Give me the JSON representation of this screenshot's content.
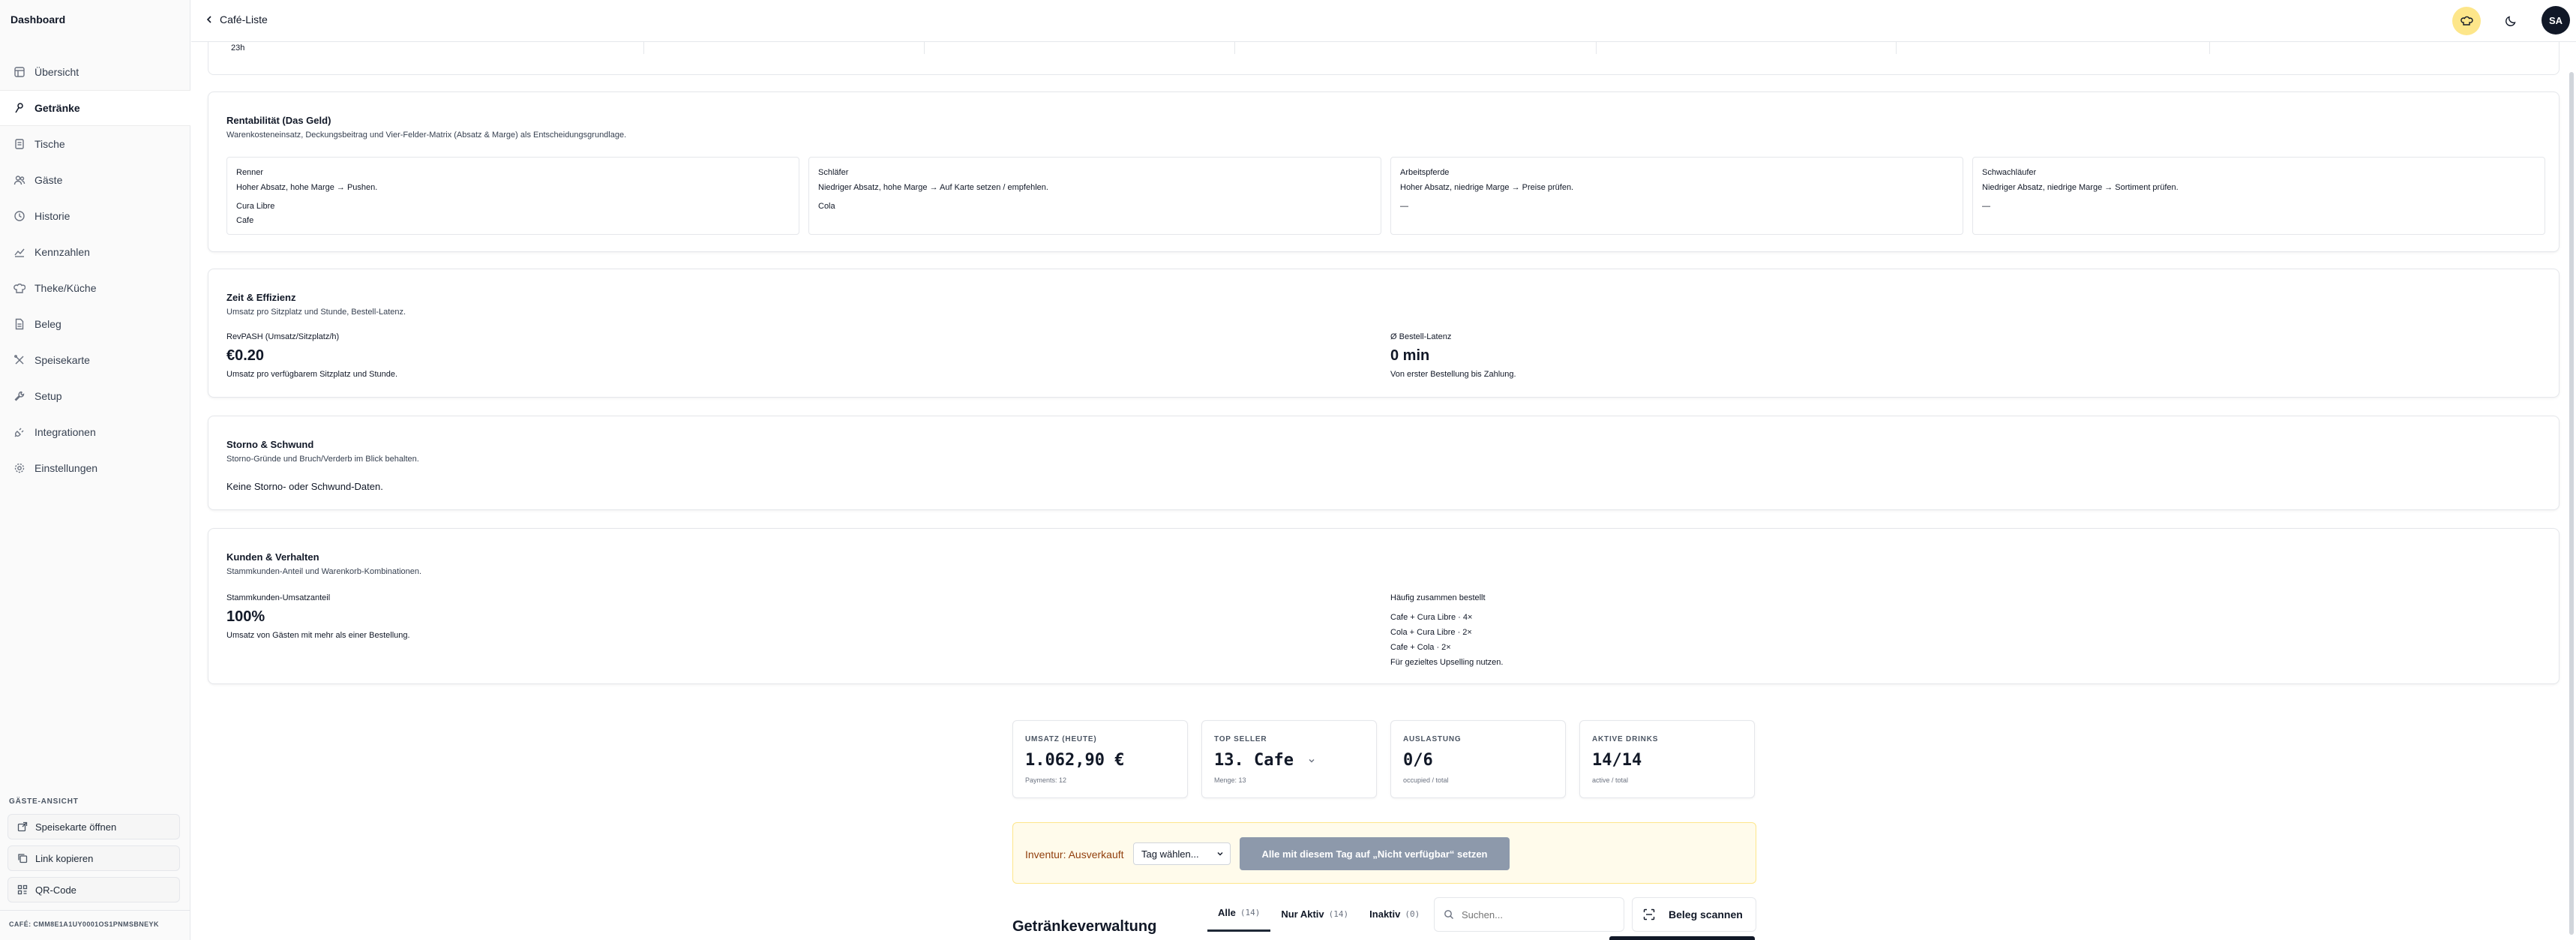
{
  "sidebar": {
    "title": "Dashboard",
    "items": [
      {
        "label": "Übersicht",
        "icon": "layout-icon"
      },
      {
        "label": "Getränke",
        "icon": "cup-icon"
      },
      {
        "label": "Tische",
        "icon": "table-icon"
      },
      {
        "label": "Gäste",
        "icon": "users-icon"
      },
      {
        "label": "Historie",
        "icon": "history-icon"
      },
      {
        "label": "Kennzahlen",
        "icon": "chart-icon"
      },
      {
        "label": "Theke/Küche",
        "icon": "chef-icon"
      },
      {
        "label": "Beleg",
        "icon": "receipt-icon"
      },
      {
        "label": "Speisekarte",
        "icon": "utensils-icon"
      },
      {
        "label": "Setup",
        "icon": "wrench-icon"
      },
      {
        "label": "Integrationen",
        "icon": "plug-icon"
      },
      {
        "label": "Einstellungen",
        "icon": "gear-icon"
      }
    ],
    "active_index": 1,
    "guest_section_label": "GÄSTE-ANSICHT",
    "guest_buttons": [
      {
        "label": "Speisekarte öffnen",
        "icon": "external-link-icon"
      },
      {
        "label": "Link kopieren",
        "icon": "copy-icon"
      },
      {
        "label": "QR-Code",
        "icon": "qr-code-icon"
      }
    ],
    "cafe_id": "CAFÉ: CMM8E1A1UY0001OS1PNMSBNEYK"
  },
  "header": {
    "back_label": "Café-Liste",
    "user_initials": "SA"
  },
  "hourly_table": {
    "last_row_label": "23h"
  },
  "rentabilitaet": {
    "title": "Rentabilität (Das Geld)",
    "subtitle": "Warenkosteneinsatz, Deckungsbeitrag und Vier-Felder-Matrix (Absatz & Marge) als Entscheidungsgrundlage.",
    "quadrants": [
      {
        "title": "Renner",
        "desc": "Hoher Absatz, hohe Marge → Pushen.",
        "items": [
          "Cura Libre",
          "Cafe"
        ]
      },
      {
        "title": "Schläfer",
        "desc": "Niedriger Absatz, hohe Marge → Auf Karte setzen / empfehlen.",
        "items": [
          "Cola"
        ]
      },
      {
        "title": "Arbeitspferde",
        "desc": "Hoher Absatz, niedrige Marge → Preise prüfen.",
        "items": [
          "—"
        ]
      },
      {
        "title": "Schwachläufer",
        "desc": "Niedriger Absatz, niedrige Marge → Sortiment prüfen.",
        "items": [
          "—"
        ]
      }
    ]
  },
  "zeit": {
    "title": "Zeit & Effizienz",
    "subtitle": "Umsatz pro Sitzplatz und Stunde, Bestell-Latenz.",
    "revpash_label": "RevPASH (Umsatz/Sitzplatz/h)",
    "revpash_value": "€0.20",
    "revpash_note": "Umsatz pro verfügbarem Sitzplatz und Stunde.",
    "latency_label": "Ø Bestell-Latenz",
    "latency_value": "0 min",
    "latency_note": "Von erster Bestellung bis Zahlung."
  },
  "storno": {
    "title": "Storno & Schwund",
    "subtitle": "Storno-Gründe und Bruch/Verderb im Blick behalten.",
    "empty": "Keine Storno- oder Schwund-Daten."
  },
  "kunden": {
    "title": "Kunden & Verhalten",
    "subtitle": "Stammkunden-Anteil und Warenkorb-Kombinationen.",
    "stamm_label": "Stammkunden-Umsatzanteil",
    "stamm_value": "100%",
    "stamm_note": "Umsatz von Gästen mit mehr als einer Bestellung.",
    "combo_label": "Häufig zusammen bestellt",
    "combos": [
      "Cafe + Cura Libre · 4×",
      "Cola + Cura Libre · 2×",
      "Cafe + Cola · 2×"
    ],
    "combo_note": "Für gezieltes Upselling nutzen."
  },
  "kpis": [
    {
      "label": "UMSATZ (HEUTE)",
      "value": "1.062,90 €",
      "sub": "Payments: 12"
    },
    {
      "label": "TOP SELLER",
      "value": "13. Cafe",
      "sub": "Menge: 13"
    },
    {
      "label": "AUSLASTUNG",
      "value": "0/6",
      "sub": "occupied / total"
    },
    {
      "label": "AKTIVE DRINKS",
      "value": "14/14",
      "sub": "active / total"
    }
  ],
  "inventur": {
    "label": "Inventur: Ausverkauft",
    "select_value": "Tag wählen...",
    "button": "Alle mit diesem Tag auf „Nicht verfügbar“ setzen"
  },
  "drinks_section": {
    "heading": "Getränkeverwaltung",
    "tabs": [
      {
        "label": "Alle",
        "count": "(14)"
      },
      {
        "label": "Nur Aktiv",
        "count": "(14)"
      },
      {
        "label": "Inaktiv",
        "count": "(0)"
      }
    ],
    "search_placeholder": "Suchen...",
    "scan_button": "Beleg scannen"
  },
  "colors": {
    "accent_avatar": "#111827",
    "theme_icon_bg": "#fde68a",
    "inventur_bg": "#fffbeb",
    "inventur_text": "#92400e",
    "disabled_button": "#8d99ab"
  }
}
